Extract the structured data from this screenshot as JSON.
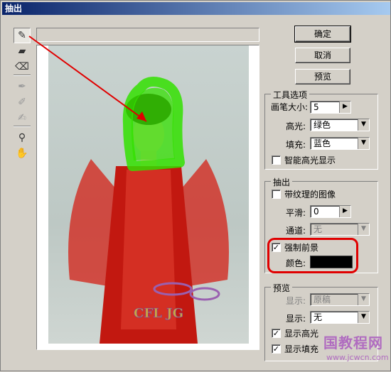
{
  "window": {
    "title": "抽出"
  },
  "tools": [
    {
      "name": "edge-highlighter-tool",
      "icon": "highlighter-icon",
      "glyph": "✎",
      "active": true,
      "disabled": false
    },
    {
      "name": "fill-tool",
      "icon": "fill-bucket-icon",
      "glyph": "▰",
      "active": false,
      "disabled": false
    },
    {
      "name": "eraser-tool",
      "icon": "eraser-icon",
      "glyph": "⌫",
      "active": false,
      "disabled": false
    },
    {
      "name": "eyedropper-tool",
      "icon": "eyedropper-icon",
      "glyph": "✒",
      "active": false,
      "disabled": true
    },
    {
      "name": "cleanup-tool",
      "icon": "cleanup-icon",
      "glyph": "✐",
      "active": false,
      "disabled": true
    },
    {
      "name": "edge-touchup-tool",
      "icon": "edge-touchup-icon",
      "glyph": "✍",
      "active": false,
      "disabled": true
    },
    {
      "name": "zoom-tool",
      "icon": "zoom-icon",
      "glyph": "⚲",
      "active": false,
      "disabled": false
    },
    {
      "name": "hand-tool",
      "icon": "hand-icon",
      "glyph": "✋",
      "active": false,
      "disabled": false
    }
  ],
  "buttons": {
    "ok": "确定",
    "cancel": "取消",
    "preview": "预览"
  },
  "tool_options": {
    "title": "工具选项",
    "brush_size_label": "画笔大小:",
    "brush_size_value": "5",
    "highlight_label": "高光:",
    "highlight_value": "绿色",
    "fill_label": "填充:",
    "fill_value": "蓝色",
    "smart_highlight_label": "智能高光显示",
    "smart_highlight_checked": false
  },
  "extraction": {
    "title": "抽出",
    "textured_label": "带纹理的图像",
    "textured_checked": false,
    "smooth_label": "平滑:",
    "smooth_value": "0",
    "channel_label": "通道:",
    "channel_value": "无",
    "force_foreground_label": "强制前景",
    "force_foreground_checked": true,
    "color_label": "颜色:",
    "color_value": "#000000"
  },
  "preview": {
    "title": "预览",
    "show1_label": "显示:",
    "show1_value": "原稿",
    "show2_label": "显示:",
    "show2_value": "无",
    "show_highlight_label": "显示高光",
    "show_highlight_checked": true,
    "show_fill_label": "显示填充",
    "show_fill_checked": true
  },
  "image": {
    "logo_text": "CFL JG",
    "highlight_color": "#33e000",
    "dress_color": "#cc1a10"
  },
  "watermark": {
    "site": "国教程网",
    "url": "www.jcwcn.com"
  },
  "colors": {
    "annotation_red": "#e00000"
  }
}
